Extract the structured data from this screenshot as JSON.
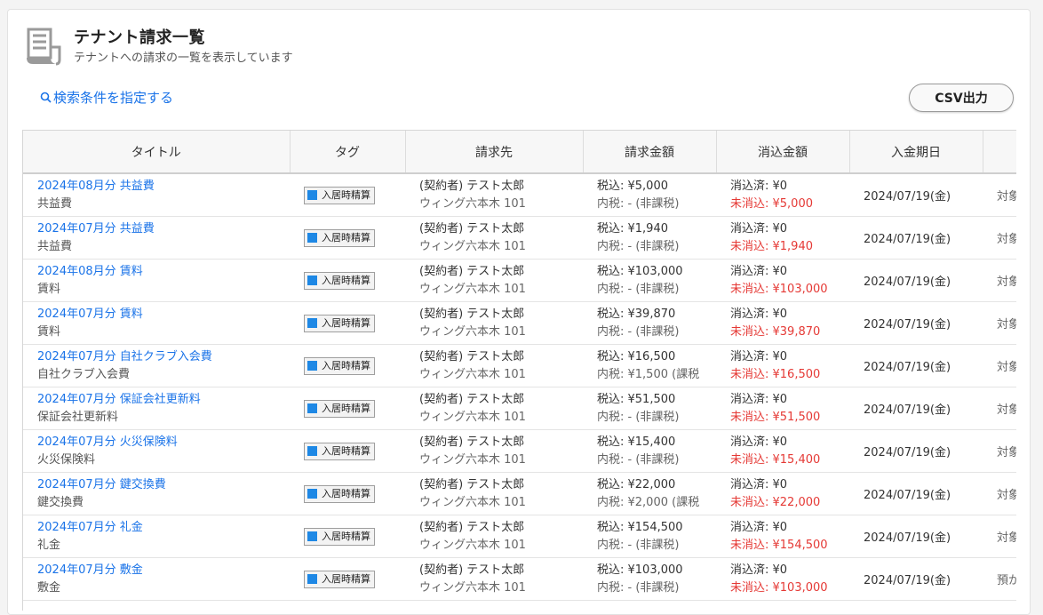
{
  "page": {
    "title": "テナント請求一覧",
    "subtitle": "テナントへの請求の一覧を表示しています",
    "search_link": "検索条件を指定する",
    "csv_button": "CSV出力"
  },
  "colors": {
    "link": "#1a73e8",
    "unpaid": "#e53935",
    "tag_swatch": "#1e88e5"
  },
  "icons": {
    "header": "document-icon",
    "search": "search-icon"
  },
  "table": {
    "headers": [
      "タイトル",
      "タグ",
      "請求先",
      "請求金額",
      "消込金額",
      "入金期日",
      ""
    ],
    "rows": [
      {
        "title": "2024年08月分 共益費",
        "subtitle": "共益費",
        "tag": "入居時精算",
        "contractor": "(契約者) テスト太郎",
        "property": "ウィング六本木 101",
        "amount": "税込: ¥5,000",
        "tax": "内税: - (非課税)",
        "paid": "消込済: ¥0",
        "unpaid": "未消込: ¥5,000",
        "due": "2024/07/19(金)",
        "extra": "対象"
      },
      {
        "title": "2024年07月分 共益費",
        "subtitle": "共益費",
        "tag": "入居時精算",
        "contractor": "(契約者) テスト太郎",
        "property": "ウィング六本木 101",
        "amount": "税込: ¥1,940",
        "tax": "内税: - (非課税)",
        "paid": "消込済: ¥0",
        "unpaid": "未消込: ¥1,940",
        "due": "2024/07/19(金)",
        "extra": "対象"
      },
      {
        "title": "2024年08月分 賃料",
        "subtitle": "賃料",
        "tag": "入居時精算",
        "contractor": "(契約者) テスト太郎",
        "property": "ウィング六本木 101",
        "amount": "税込: ¥103,000",
        "tax": "内税: - (非課税)",
        "paid": "消込済: ¥0",
        "unpaid": "未消込: ¥103,000",
        "due": "2024/07/19(金)",
        "extra": "対象"
      },
      {
        "title": "2024年07月分 賃料",
        "subtitle": "賃料",
        "tag": "入居時精算",
        "contractor": "(契約者) テスト太郎",
        "property": "ウィング六本木 101",
        "amount": "税込: ¥39,870",
        "tax": "内税: - (非課税)",
        "paid": "消込済: ¥0",
        "unpaid": "未消込: ¥39,870",
        "due": "2024/07/19(金)",
        "extra": "対象"
      },
      {
        "title": "2024年07月分 自社クラブ入会費",
        "subtitle": "自社クラブ入会費",
        "tag": "入居時精算",
        "contractor": "(契約者) テスト太郎",
        "property": "ウィング六本木 101",
        "amount": "税込: ¥16,500",
        "tax": "内税: ¥1,500 (課税",
        "paid": "消込済: ¥0",
        "unpaid": "未消込: ¥16,500",
        "due": "2024/07/19(金)",
        "extra": "対象"
      },
      {
        "title": "2024年07月分 保証会社更新料",
        "subtitle": "保証会社更新料",
        "tag": "入居時精算",
        "contractor": "(契約者) テスト太郎",
        "property": "ウィング六本木 101",
        "amount": "税込: ¥51,500",
        "tax": "内税: - (非課税)",
        "paid": "消込済: ¥0",
        "unpaid": "未消込: ¥51,500",
        "due": "2024/07/19(金)",
        "extra": "対象"
      },
      {
        "title": "2024年07月分 火災保険料",
        "subtitle": "火災保険料",
        "tag": "入居時精算",
        "contractor": "(契約者) テスト太郎",
        "property": "ウィング六本木 101",
        "amount": "税込: ¥15,400",
        "tax": "内税: - (非課税)",
        "paid": "消込済: ¥0",
        "unpaid": "未消込: ¥15,400",
        "due": "2024/07/19(金)",
        "extra": "対象"
      },
      {
        "title": "2024年07月分 鍵交換費",
        "subtitle": "鍵交換費",
        "tag": "入居時精算",
        "contractor": "(契約者) テスト太郎",
        "property": "ウィング六本木 101",
        "amount": "税込: ¥22,000",
        "tax": "内税: ¥2,000 (課税",
        "paid": "消込済: ¥0",
        "unpaid": "未消込: ¥22,000",
        "due": "2024/07/19(金)",
        "extra": "対象"
      },
      {
        "title": "2024年07月分 礼金",
        "subtitle": "礼金",
        "tag": "入居時精算",
        "contractor": "(契約者) テスト太郎",
        "property": "ウィング六本木 101",
        "amount": "税込: ¥154,500",
        "tax": "内税: - (非課税)",
        "paid": "消込済: ¥0",
        "unpaid": "未消込: ¥154,500",
        "due": "2024/07/19(金)",
        "extra": "対象"
      },
      {
        "title": "2024年07月分 敷金",
        "subtitle": "敷金",
        "tag": "入居時精算",
        "contractor": "(契約者) テスト太郎",
        "property": "ウィング六本木 101",
        "amount": "税込: ¥103,000",
        "tax": "内税: - (非課税)",
        "paid": "消込済: ¥0",
        "unpaid": "未消込: ¥103,000",
        "due": "2024/07/19(金)",
        "extra": "預か"
      }
    ]
  }
}
